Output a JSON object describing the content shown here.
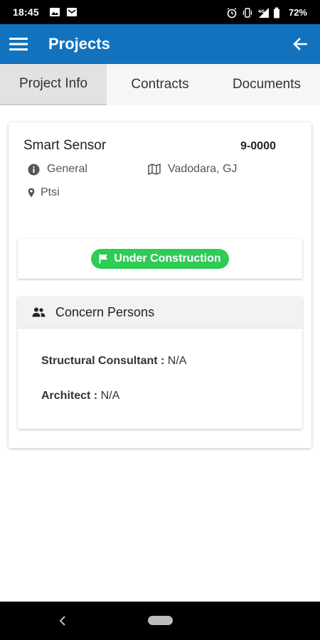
{
  "status_bar": {
    "time": "18:45",
    "battery": "72%",
    "network": "4G"
  },
  "app_bar": {
    "title": "Projects"
  },
  "tabs": [
    {
      "label": "Project Info",
      "active": true
    },
    {
      "label": "Contracts",
      "active": false
    },
    {
      "label": "Documents",
      "active": false
    }
  ],
  "project": {
    "name": "Smart Sensor",
    "code": "9-0000",
    "type": "General",
    "location": "Vadodara, GJ",
    "organization": "Ptsi"
  },
  "status": {
    "label": "Under Construction",
    "color": "#2ecc55"
  },
  "concern_persons": {
    "title": "Concern Persons",
    "items": [
      {
        "role": "Structural Consultant :",
        "value": "N/A"
      },
      {
        "role": "Architect :",
        "value": "N/A"
      }
    ]
  },
  "colors": {
    "primary": "#1272bd",
    "status_green": "#2ecc55"
  },
  "icons": {
    "menu": "hamburger-icon",
    "back": "arrow-left-icon",
    "type": "info-circle-icon",
    "location": "map-icon",
    "organization": "map-pin-icon",
    "status": "flag-icon",
    "persons": "users-icon"
  }
}
